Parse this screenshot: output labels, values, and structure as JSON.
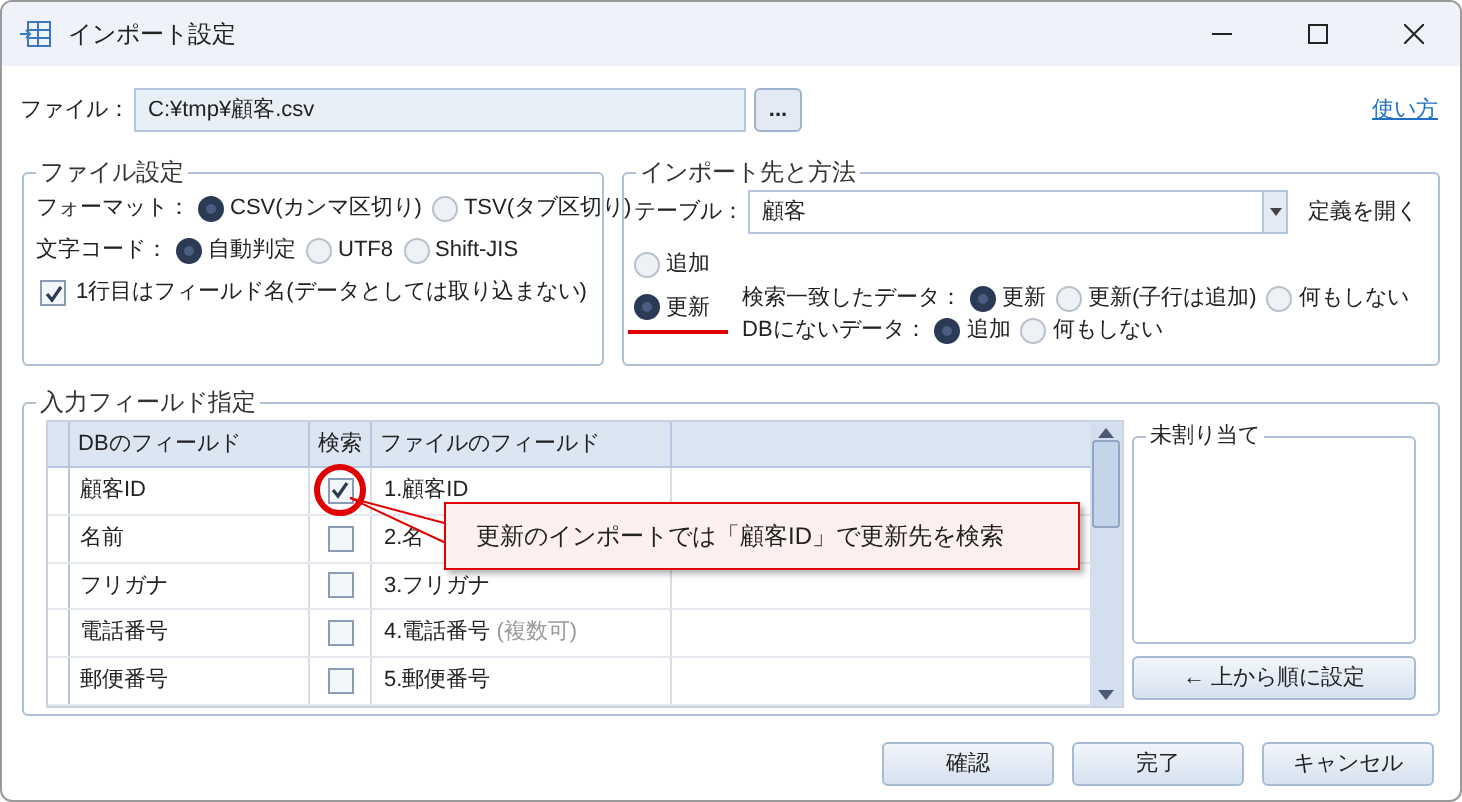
{
  "window": {
    "title": "インポート設定"
  },
  "file": {
    "label": "ファイル：",
    "value": "C:¥tmp¥顧客.csv",
    "browse": "...",
    "help_link": "使い方"
  },
  "file_settings": {
    "title": "ファイル設定",
    "format": {
      "label": "フォーマット：",
      "options": [
        {
          "label": "CSV(カンマ区切り)",
          "selected": true
        },
        {
          "label": "TSV(タブ区切り)",
          "selected": false
        }
      ]
    },
    "encoding": {
      "label": "文字コード：",
      "options": [
        {
          "label": "自動判定",
          "selected": true
        },
        {
          "label": "UTF8",
          "selected": false
        },
        {
          "label": "Shift-JIS",
          "selected": false
        }
      ]
    },
    "header_row": {
      "label": "1行目はフィールド名(データとしては取り込まない)",
      "checked": true
    }
  },
  "import_target": {
    "title": "インポート先と方法",
    "table": {
      "label": "テーブル：",
      "value": "顧客"
    },
    "open_definition": "定義を開く",
    "modes": [
      {
        "label": "追加",
        "selected": false,
        "highlighted": false
      },
      {
        "label": "更新",
        "selected": true,
        "highlighted": true
      }
    ],
    "matched": {
      "label": "検索一致したデータ：",
      "options": [
        {
          "label": "更新",
          "selected": true
        },
        {
          "label": "更新(子行は追加)",
          "selected": false
        },
        {
          "label": "何もしない",
          "selected": false
        }
      ]
    },
    "unmatched": {
      "label": "DBにないデータ：",
      "options": [
        {
          "label": "追加",
          "selected": true
        },
        {
          "label": "何もしない",
          "selected": false
        }
      ]
    }
  },
  "input_fields": {
    "title": "入力フィールド指定",
    "columns": [
      "DBのフィールド",
      "検索",
      "ファイルのフィールド"
    ],
    "rows": [
      {
        "db_field": "顧客ID",
        "search": true,
        "highlighted": true,
        "file_field": "1.顧客ID"
      },
      {
        "db_field": "名前",
        "search": false,
        "highlighted": false,
        "file_field": "2.名"
      },
      {
        "db_field": "フリガナ",
        "search": false,
        "highlighted": false,
        "file_field": "3.フリガナ"
      },
      {
        "db_field": "電話番号",
        "search": false,
        "highlighted": false,
        "file_field": "4.電話番号",
        "note": "(複数可)"
      },
      {
        "db_field": "郵便番号",
        "search": false,
        "highlighted": false,
        "file_field": "5.郵便番号"
      }
    ],
    "callout": "更新のインポートでは「顧客ID」で更新先を検索",
    "unassigned": {
      "title": "未割り当て"
    },
    "assign_button": "← 上から順に設定"
  },
  "buttons": [
    "確認",
    "完了",
    "キャンセル"
  ]
}
